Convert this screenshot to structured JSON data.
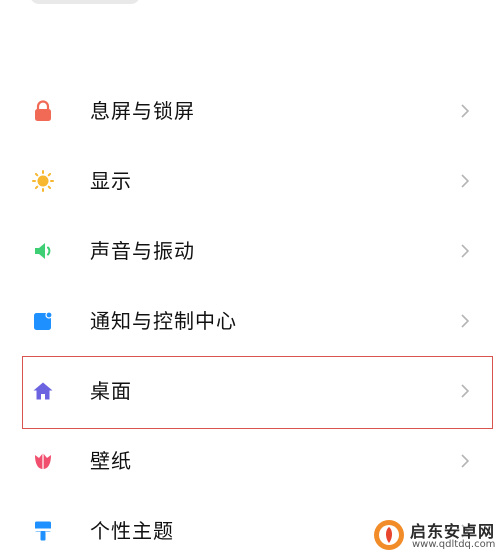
{
  "settings": {
    "items": [
      {
        "label": "息屏与锁屏",
        "icon": "lock-icon",
        "color": "#f06a55"
      },
      {
        "label": "显示",
        "icon": "sun-icon",
        "color": "#f7b731"
      },
      {
        "label": "声音与振动",
        "icon": "speaker-icon",
        "color": "#3ecf74"
      },
      {
        "label": "通知与控制中心",
        "icon": "notification-icon",
        "color": "#1e90ff"
      },
      {
        "label": "桌面",
        "icon": "home-icon",
        "color": "#6c63e0",
        "selected": true
      },
      {
        "label": "壁纸",
        "icon": "tulip-icon",
        "color": "#f0506e"
      },
      {
        "label": "个性主题",
        "icon": "brush-icon",
        "color": "#1e90ff"
      }
    ]
  },
  "colors": {
    "highlight_border": "#d9534f",
    "chevron": "#b5b5b5",
    "text": "#111111"
  },
  "watermark": {
    "title": "启东安卓网",
    "url": "www.qdltdq.com",
    "icon": "watermark-logo-icon"
  }
}
